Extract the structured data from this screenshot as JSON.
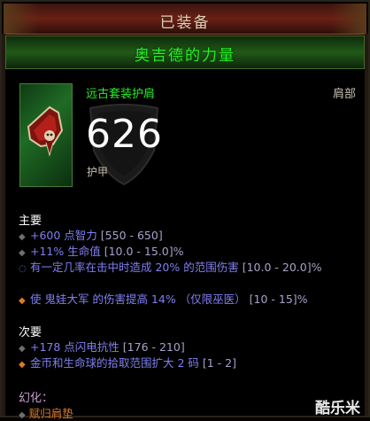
{
  "header": {
    "equipped_label": "已装备"
  },
  "item": {
    "name": "奥吉德的力量",
    "type": "远古套装护肩",
    "slot": "肩部",
    "armor_value": "626",
    "armor_label": "护甲",
    "icon": "shoulders-icon"
  },
  "primary": {
    "heading": "主要",
    "stats": [
      {
        "text": "+600 点智力",
        "range": " [550 - 650]"
      },
      {
        "text": "+11% 生命值",
        "range": " [10.0 - 15.0]%"
      },
      {
        "text": "有一定几率在击中时造成 20% 的范围伤害",
        "range": " [10.0 - 20.0]%"
      },
      {
        "text": "使 鬼娃大军 的伤害提高 14% （仅限巫医）",
        "range": " [10 - 15]%"
      }
    ]
  },
  "secondary": {
    "heading": "次要",
    "stats": [
      {
        "text": "+178 点闪电抗性",
        "range": " [176 - 210]"
      },
      {
        "text": "金币和生命球的拾取范围扩大 2 码",
        "range": " [1 - 2]"
      }
    ]
  },
  "transmog": {
    "heading": "幻化：",
    "value": "赋归肩垫"
  },
  "watermark": "酷乐米",
  "colors": {
    "set_green": "#27ef27",
    "magic_blue": "#7f7ff2",
    "legendary_orange": "#e0792a"
  }
}
